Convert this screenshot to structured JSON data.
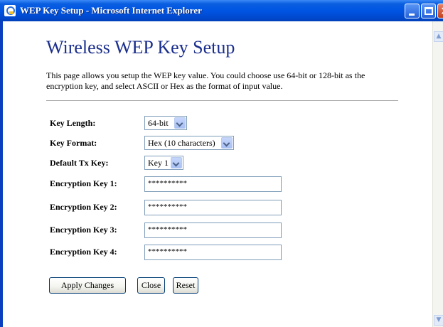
{
  "window": {
    "title": "WEP Key Setup - Microsoft Internet Explorer"
  },
  "page": {
    "title": "Wireless WEP Key Setup",
    "description": "This page allows you setup the WEP key value. You could choose use 64-bit or 128-bit as the encryption key, and select ASCII or Hex as the format of input value."
  },
  "form": {
    "key_length": {
      "label": "Key Length:",
      "value": "64-bit"
    },
    "key_format": {
      "label": "Key Format:",
      "value": "Hex (10 characters)"
    },
    "default_tx_key": {
      "label": "Default Tx Key:",
      "value": "Key 1"
    },
    "keys": [
      {
        "label": "Encryption Key 1:",
        "value": "**********"
      },
      {
        "label": "Encryption Key 2:",
        "value": "**********"
      },
      {
        "label": "Encryption Key 3:",
        "value": "**********"
      },
      {
        "label": "Encryption Key 4:",
        "value": "**********"
      }
    ]
  },
  "buttons": {
    "apply": "Apply Changes",
    "close": "Close",
    "reset": "Reset"
  },
  "icons": {
    "window": "ie-page-icon",
    "minimize": "minimize-icon",
    "maximize": "maximize-icon",
    "close": "close-icon",
    "scroll_up": "scroll-up-arrow-icon",
    "scroll_down": "scroll-down-arrow-icon",
    "dropdown": "chevron-down-icon"
  },
  "colors": {
    "title_bar": "#0054e3",
    "heading": "#1a2e8c"
  }
}
